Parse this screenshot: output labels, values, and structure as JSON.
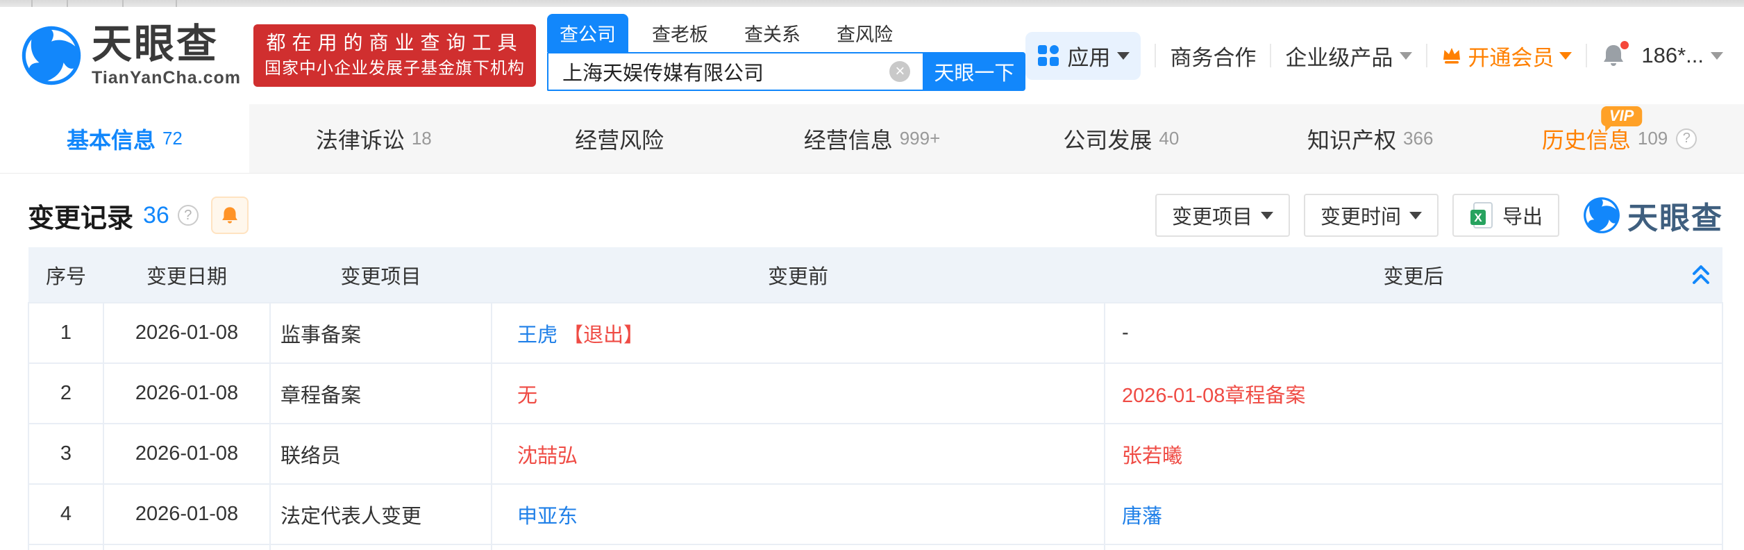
{
  "header": {
    "logo": {
      "brand": "天眼查",
      "domain": "TianYanCha.com"
    },
    "promo": {
      "line1": "都在用的商业查询工具",
      "line2": "国家中小企业发展子基金旗下机构"
    },
    "search": {
      "tabs": [
        {
          "label": "查公司"
        },
        {
          "label": "查老板"
        },
        {
          "label": "查关系"
        },
        {
          "label": "查风险"
        }
      ],
      "value": "上海天娱传媒有限公司",
      "submit": "天眼一下"
    },
    "menu": {
      "apps": "应用",
      "cooperation": "商务合作",
      "enterprise": "企业级产品",
      "vip": "开通会员",
      "user": "186*..."
    }
  },
  "page_tabs": [
    {
      "label": "基本信息",
      "count": "72"
    },
    {
      "label": "法律诉讼",
      "count": "18"
    },
    {
      "label": "经营风险",
      "count": ""
    },
    {
      "label": "经营信息",
      "count": "999+"
    },
    {
      "label": "公司发展",
      "count": "40"
    },
    {
      "label": "知识产权",
      "count": "366"
    },
    {
      "label": "历史信息",
      "count": "109",
      "badge": "VIP"
    }
  ],
  "section": {
    "title": "变更记录",
    "count": "36",
    "filter_item": "变更项目",
    "filter_time": "变更时间",
    "export_label": "导出",
    "watermark": "天眼查"
  },
  "table": {
    "headers": [
      "序号",
      "变更日期",
      "变更项目",
      "变更前",
      "变更后"
    ],
    "rows": [
      {
        "no": "1",
        "date": "2026-01-08",
        "item": "监事备案",
        "before": [
          {
            "text": "王虎 ",
            "style": "link"
          },
          {
            "text": "【退出】",
            "style": "red"
          }
        ],
        "after": [
          {
            "text": "-",
            "style": "plain"
          }
        ]
      },
      {
        "no": "2",
        "date": "2026-01-08",
        "item": "章程备案",
        "before": [
          {
            "text": "无",
            "style": "red"
          }
        ],
        "after": [
          {
            "text": "2026-01-08章程备案",
            "style": "red"
          }
        ]
      },
      {
        "no": "3",
        "date": "2026-01-08",
        "item": "联络员",
        "before": [
          {
            "text": "沈喆弘",
            "style": "red"
          }
        ],
        "after": [
          {
            "text": "张若曦",
            "style": "red"
          }
        ]
      },
      {
        "no": "4",
        "date": "2026-01-08",
        "item": "法定代表人变更",
        "before": [
          {
            "text": "申亚东",
            "style": "link"
          }
        ],
        "after": [
          {
            "text": "唐藩",
            "style": "link"
          }
        ]
      }
    ]
  },
  "colors": {
    "brand": "#1287fb",
    "link": "#2080e8",
    "red": "#ef4b44",
    "orange": "#ff8000",
    "promo_red": "#d02f2f"
  }
}
